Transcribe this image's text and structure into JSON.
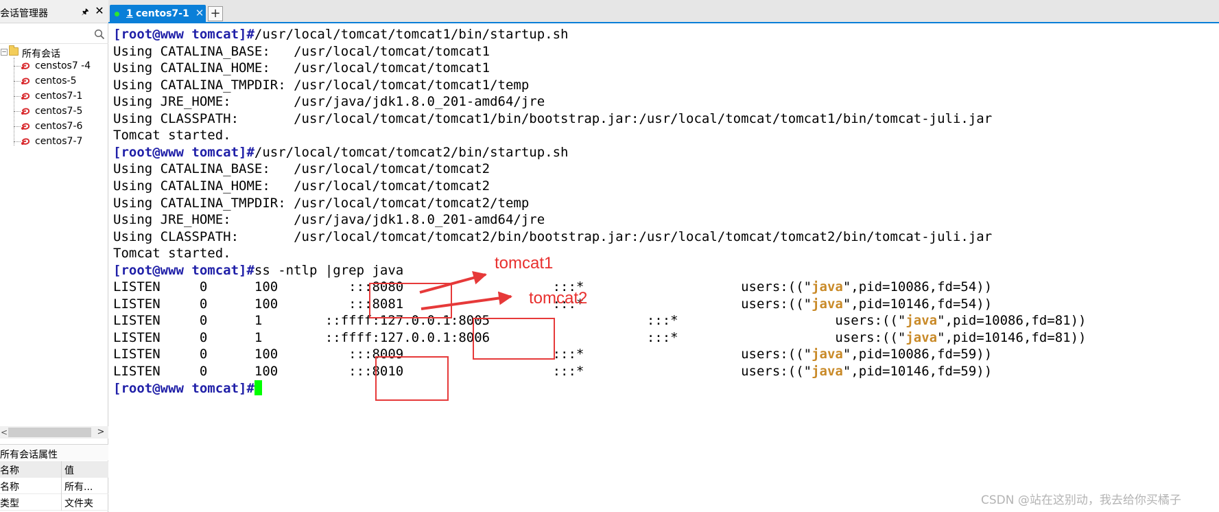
{
  "panel": {
    "title": "会话管理器",
    "root": "所有会话",
    "sessions": [
      "censtos7 -4",
      "centos-5",
      "centos7-1",
      "centos7-5",
      "centos7-6",
      "centos7-7"
    ],
    "props_title": "所有会话属性",
    "props_headers": [
      "名称",
      "值"
    ],
    "props_rows": [
      [
        "名称",
        "所有..."
      ],
      [
        "类型",
        "文件夹"
      ]
    ]
  },
  "tab": {
    "number": "1",
    "label": "centos7-1"
  },
  "terminal": {
    "prompt": "[root@www tomcat]#",
    "lines": [
      {
        "type": "cmd",
        "text": "/usr/local/tomcat/tomcat1/bin/startup.sh"
      },
      {
        "type": "out",
        "text": "Using CATALINA_BASE:   /usr/local/tomcat/tomcat1"
      },
      {
        "type": "out",
        "text": "Using CATALINA_HOME:   /usr/local/tomcat/tomcat1"
      },
      {
        "type": "out",
        "text": "Using CATALINA_TMPDIR: /usr/local/tomcat/tomcat1/temp"
      },
      {
        "type": "out",
        "text": "Using JRE_HOME:        /usr/java/jdk1.8.0_201-amd64/jre"
      },
      {
        "type": "out",
        "text": "Using CLASSPATH:       /usr/local/tomcat/tomcat1/bin/bootstrap.jar:/usr/local/tomcat/tomcat1/bin/tomcat-juli.jar"
      },
      {
        "type": "out",
        "text": "Tomcat started."
      },
      {
        "type": "cmd",
        "text": "/usr/local/tomcat/tomcat2/bin/startup.sh"
      },
      {
        "type": "out",
        "text": "Using CATALINA_BASE:   /usr/local/tomcat/tomcat2"
      },
      {
        "type": "out",
        "text": "Using CATALINA_HOME:   /usr/local/tomcat/tomcat2"
      },
      {
        "type": "out",
        "text": "Using CATALINA_TMPDIR: /usr/local/tomcat/tomcat2/temp"
      },
      {
        "type": "out",
        "text": "Using JRE_HOME:        /usr/java/jdk1.8.0_201-amd64/jre"
      },
      {
        "type": "out",
        "text": "Using CLASSPATH:       /usr/local/tomcat/tomcat2/bin/bootstrap.jar:/usr/local/tomcat/tomcat2/bin/tomcat-juli.jar"
      },
      {
        "type": "out",
        "text": "Tomcat started."
      },
      {
        "type": "cmd",
        "text": "ss -ntlp |grep java"
      },
      {
        "type": "ss",
        "pre": "LISTEN     0      100         :::8080                   :::*                    users:((\"",
        "hl": "java",
        "post": "\",pid=10086,fd=54))"
      },
      {
        "type": "ss",
        "pre": "LISTEN     0      100         :::8081                   :::*                    users:((\"",
        "hl": "java",
        "post": "\",pid=10146,fd=54))"
      },
      {
        "type": "ss",
        "pre": "LISTEN     0      1        ::ffff:127.0.0.1:8005                    :::*                    users:((\"",
        "hl": "java",
        "post": "\",pid=10086,fd=81))"
      },
      {
        "type": "ss",
        "pre": "LISTEN     0      1        ::ffff:127.0.0.1:8006                    :::*                    users:((\"",
        "hl": "java",
        "post": "\",pid=10146,fd=81))"
      },
      {
        "type": "ss",
        "pre": "LISTEN     0      100         :::8009                   :::*                    users:((\"",
        "hl": "java",
        "post": "\",pid=10086,fd=59))"
      },
      {
        "type": "ss",
        "pre": "LISTEN     0      100         :::8010                   :::*                    users:((\"",
        "hl": "java",
        "post": "\",pid=10146,fd=59))"
      },
      {
        "type": "cmd",
        "text": ""
      }
    ]
  },
  "annotations": {
    "label1": "tomcat1",
    "label2": "tomcat2",
    "color": "#e63939"
  },
  "watermark": "CSDN @站在这别动，我去给你买橘子"
}
